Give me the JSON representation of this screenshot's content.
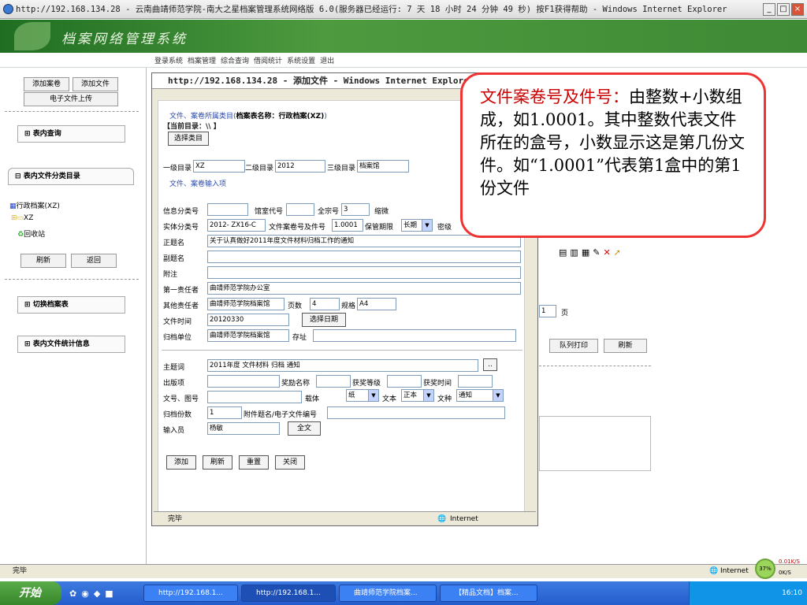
{
  "browser": {
    "title": "http://192.168.134.28 - 云南曲靖师范学院-南大之星档案管理系统网络版 6.0(服务器已经运行: 7 天 18 小时 24 分钟 49 秒) 按F1获得帮助 - Windows Internet Explorer",
    "status": "完毕",
    "zone": "Internet"
  },
  "banner": {
    "title": "档案网络管理系统"
  },
  "menu": [
    "登录系统",
    "档案管理",
    "综合查询",
    "借阅统计",
    "系统设置",
    "退出"
  ],
  "left": {
    "add_volume": "添加案卷",
    "add_file": "添加文件",
    "upload": "电子文件上传",
    "query": "表内查询",
    "catalog": "表内文件分类目录",
    "tree_root": "行政档案(XZ)",
    "tree_xz": "XZ",
    "tree_recycle": "回收站",
    "refresh": "刷新",
    "back": "返回",
    "switch": "切换档案表",
    "stats": "表内文件统计信息"
  },
  "right": {
    "page_value": "1",
    "page_unit": "页",
    "queue_print": "队列打印",
    "refresh": "刷新"
  },
  "popup": {
    "title": "http://192.168.134.28 - 添加文件 - Windows Internet Explorer",
    "section1": "文件、案卷所属类目(",
    "table_name": "档案表名称：行政档案(XZ)",
    "section1_end": ")",
    "current_dir": "【当前目录：\\\\ 】",
    "choose_category": "选择类目",
    "level1_label": "一级目录",
    "level1_value": "XZ",
    "level2_label": "二级目录",
    "level2_value": "2012",
    "level3_label": "三级目录",
    "level3_value": "档案馆",
    "section2": "文件、案卷输入项",
    "info_class_label": "信息分类号",
    "room_code_label": "馆室代号",
    "fonds_label": "全宗号",
    "fonds_value": "3",
    "micro_label": "缩微",
    "entity_class_label": "实体分类号",
    "entity_class_value": "2012- ZX16-C",
    "file_no_label": "文件案卷号及件号",
    "file_no_value": "1.0001",
    "retention_label": "保管期限",
    "retention_value": "长期",
    "secret_label": "密级",
    "title_label": "正题名",
    "title_value": "关于认真做好2011年度文件材料归档工作的通知",
    "subtitle_label": "副题名",
    "note_label": "附注",
    "first_resp_label": "第一责任者",
    "first_resp_value": "曲靖师范学院办公室",
    "other_resp_label": "其他责任者",
    "other_resp_value": "曲靖师范学院档案馆",
    "pages_label": "页数",
    "pages_value": "4",
    "spec_label": "规格",
    "spec_value": "A4",
    "date_label": "文件时间",
    "date_value": "20120330",
    "choose_date": "选择日期",
    "archive_unit_label": "归档单位",
    "archive_unit_value": "曲靖师范学院档案馆",
    "location_label": "存址",
    "keywords_label": "主题词",
    "keywords_value": "2011年度  文件材料  归档  通知",
    "more_button": "..",
    "publish_label": "出版项",
    "award_name_label": "奖励名称",
    "award_level_label": "获奖等级",
    "award_time_label": "获奖时间",
    "doc_no_label": "文号、图号",
    "carrier_label": "载体",
    "carrier_value": "纸",
    "text_label": "文本",
    "text_value": "正本",
    "genre_label": "文种",
    "genre_value": "通知",
    "copies_label": "归档份数",
    "copies_value": "1",
    "attach_label": "附件题名/电子文件编号",
    "entry_label": "输入员",
    "entry_value": "杨敏",
    "fulltext_button": "全文",
    "add_button": "添加",
    "refresh_button": "刷新",
    "reset_button": "重置",
    "close_button": "关闭",
    "status": "完毕",
    "zone": "Internet"
  },
  "callout": {
    "head": "文件案卷号及件号：",
    "body": "由整数+小数组成，如1.0001。其中整数代表文件所在的盒号，小数显示这是第几份文件。如“1.0001”代表第1盒中的第1份文件"
  },
  "taskbar": {
    "start": "开始",
    "tasks": [
      "http://192.168.1...",
      "http://192.168.1...",
      "曲靖师范学院档案...",
      "【精品文档】档案..."
    ],
    "clock": "16:10",
    "net_percent": "37%",
    "net_up": "0.01K/S",
    "net_down": "0K/S"
  },
  "colors": {
    "banner": "#2f7d2c",
    "callout_border": "#e33333",
    "callout_head": "#cc0000",
    "link_blue": "#2a4ab0"
  }
}
